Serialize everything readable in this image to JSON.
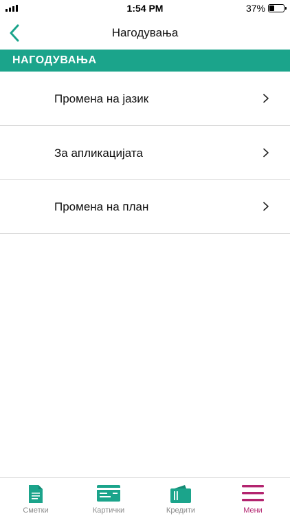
{
  "status_bar": {
    "time": "1:54 PM",
    "battery_text": "37%",
    "battery_level": 0.37,
    "icons": [
      "cellular-signal-icon",
      "battery-icon"
    ]
  },
  "nav": {
    "title": "Нагодувања",
    "back_icon": "chevron-left-icon"
  },
  "section_header": {
    "title": "НАГОДУВАЊА"
  },
  "menu": {
    "items": [
      {
        "label": "Промена на јазик",
        "icon": "chevron-right-icon"
      },
      {
        "label": "За апликацијата",
        "icon": "chevron-right-icon"
      },
      {
        "label": "Промена на план",
        "icon": "chevron-right-icon"
      }
    ]
  },
  "tab_bar": {
    "tabs": [
      {
        "label": "Сметки",
        "icon": "document-icon",
        "active": false
      },
      {
        "label": "Картички",
        "icon": "card-icon",
        "active": false
      },
      {
        "label": "Кредити",
        "icon": "wallet-icon",
        "active": false
      },
      {
        "label": "Мени",
        "icon": "menu-icon",
        "active": true
      }
    ]
  },
  "colors": {
    "accent": "#1ba48b",
    "active_tab": "#b3246f",
    "inactive_tab": "#8a8a8a",
    "divider": "#d9d9d9"
  }
}
